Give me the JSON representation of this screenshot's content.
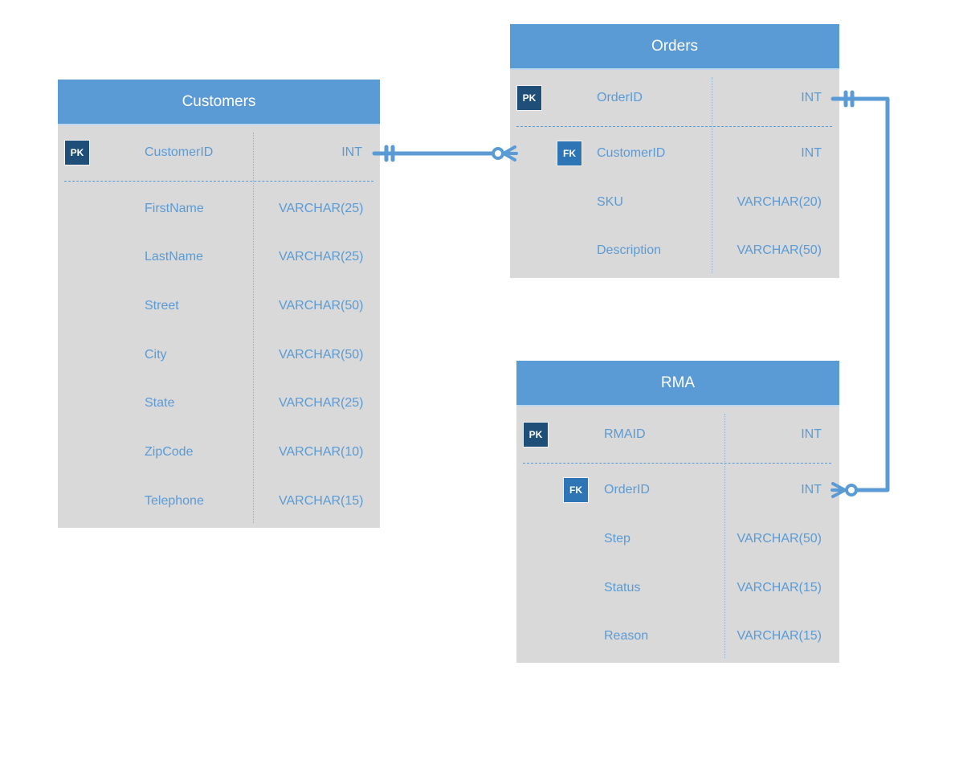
{
  "colors": {
    "header": "#5b9bd5",
    "body": "#d9d9d9",
    "text": "#5b9bd5",
    "pk_badge": "#1f4e79",
    "fk_badge": "#2e75b6",
    "connector": "#5b9bd5"
  },
  "entities": {
    "customers": {
      "title": "Customers",
      "fields": [
        {
          "key": "PK",
          "name": "CustomerID",
          "type": "INT"
        },
        {
          "key": "",
          "name": "FirstName",
          "type": "VARCHAR(25)"
        },
        {
          "key": "",
          "name": "LastName",
          "type": "VARCHAR(25)"
        },
        {
          "key": "",
          "name": "Street",
          "type": "VARCHAR(50)"
        },
        {
          "key": "",
          "name": "City",
          "type": "VARCHAR(50)"
        },
        {
          "key": "",
          "name": "State",
          "type": "VARCHAR(25)"
        },
        {
          "key": "",
          "name": "ZipCode",
          "type": "VARCHAR(10)"
        },
        {
          "key": "",
          "name": "Telephone",
          "type": "VARCHAR(15)"
        }
      ]
    },
    "orders": {
      "title": "Orders",
      "fields": [
        {
          "key": "PK",
          "name": "OrderID",
          "type": "INT"
        },
        {
          "key": "FK",
          "name": "CustomerID",
          "type": "INT"
        },
        {
          "key": "",
          "name": "SKU",
          "type": "VARCHAR(20)"
        },
        {
          "key": "",
          "name": "Description",
          "type": "VARCHAR(50)"
        }
      ]
    },
    "rma": {
      "title": "RMA",
      "fields": [
        {
          "key": "PK",
          "name": "RMAID",
          "type": "INT"
        },
        {
          "key": "FK",
          "name": "OrderID",
          "type": "INT"
        },
        {
          "key": "",
          "name": "Step",
          "type": "VARCHAR(50)"
        },
        {
          "key": "",
          "name": "Status",
          "type": "VARCHAR(15)"
        },
        {
          "key": "",
          "name": "Reason",
          "type": "VARCHAR(15)"
        }
      ]
    }
  },
  "relationships": [
    {
      "from": "Customers.CustomerID",
      "to": "Orders.CustomerID",
      "from_cardinality": "one-and-only-one",
      "to_cardinality": "zero-or-many"
    },
    {
      "from": "Orders.OrderID",
      "to": "RMA.OrderID",
      "from_cardinality": "one-and-only-one",
      "to_cardinality": "zero-or-many"
    }
  ]
}
